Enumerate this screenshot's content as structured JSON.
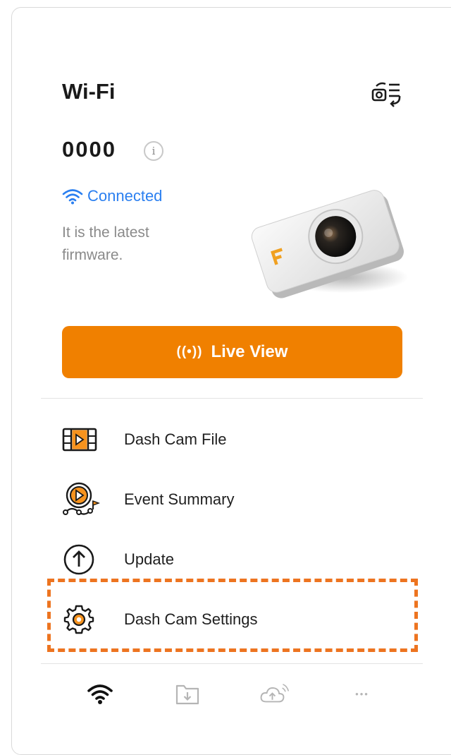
{
  "header": {
    "title": "Wi-Fi",
    "switch_icon": "camera-list-switch-icon"
  },
  "device": {
    "name": "0000",
    "info_icon_glyph": "i"
  },
  "status": {
    "connection": "Connected",
    "firmware_message": "It is the latest firmware.",
    "accent_color": "#2a7ff0"
  },
  "live_view": {
    "icon_glyph": "((•))",
    "label": "Live View",
    "color": "#f08000"
  },
  "menu": {
    "items": [
      {
        "label": "Dash Cam File",
        "icon": "video-file-icon"
      },
      {
        "label": "Event Summary",
        "icon": "event-summary-icon"
      },
      {
        "label": "Update",
        "icon": "update-arrow-icon"
      },
      {
        "label": "Dash Cam Settings",
        "icon": "settings-gear-icon"
      }
    ],
    "highlighted_item": "Dash Cam Settings",
    "highlight_color": "#ed7420"
  },
  "tabbar": {
    "tabs": [
      {
        "icon": "wifi-icon",
        "active": true
      },
      {
        "icon": "download-folder-icon",
        "active": false
      },
      {
        "icon": "cloud-upload-icon",
        "active": false
      },
      {
        "icon": "more-icon",
        "active": false
      }
    ],
    "more_glyph": "•••"
  }
}
